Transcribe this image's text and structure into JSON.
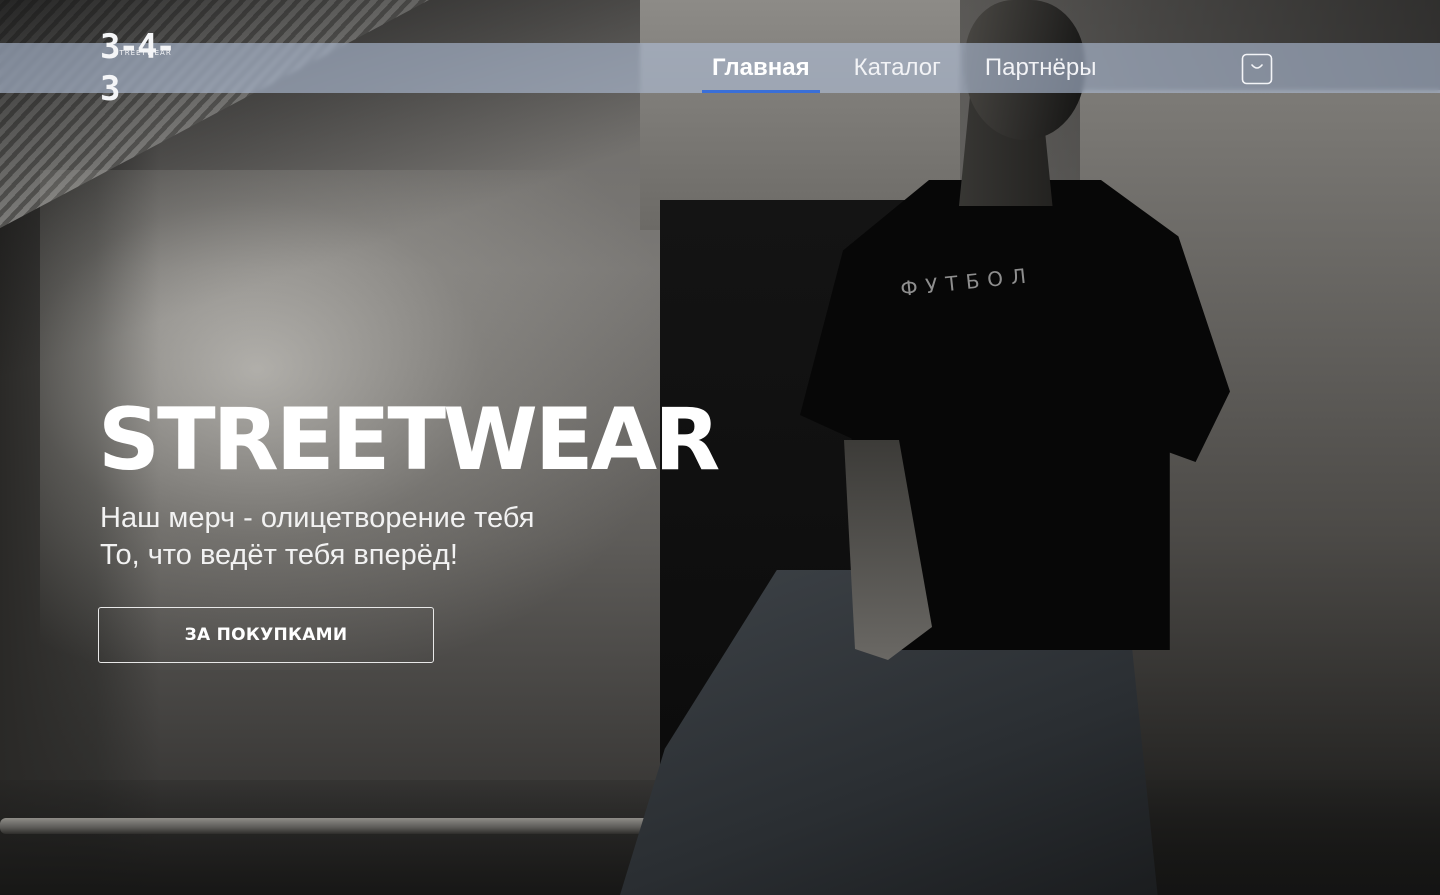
{
  "header": {
    "logo": {
      "digits": "3-4-3",
      "tagline": "STREETWEAR"
    },
    "nav": [
      {
        "label": "Главная",
        "active": true
      },
      {
        "label": "Каталог",
        "active": false
      },
      {
        "label": "Партнёры",
        "active": false
      }
    ],
    "cart_icon": "shopping-bag-icon"
  },
  "hero": {
    "title": "STREETWEAR",
    "subtitle_lines": [
      "Наш мерч - олицетворение тебя",
      "То, что ведёт тебя вперёд!"
    ],
    "cta_label": "ЗА ПОКУПКАМИ",
    "shirt_print": "ФУТБОЛ"
  },
  "colors": {
    "header_bg": "#b0bed6",
    "nav_active_underline": "#3a6fd8",
    "text": "#ffffff"
  }
}
